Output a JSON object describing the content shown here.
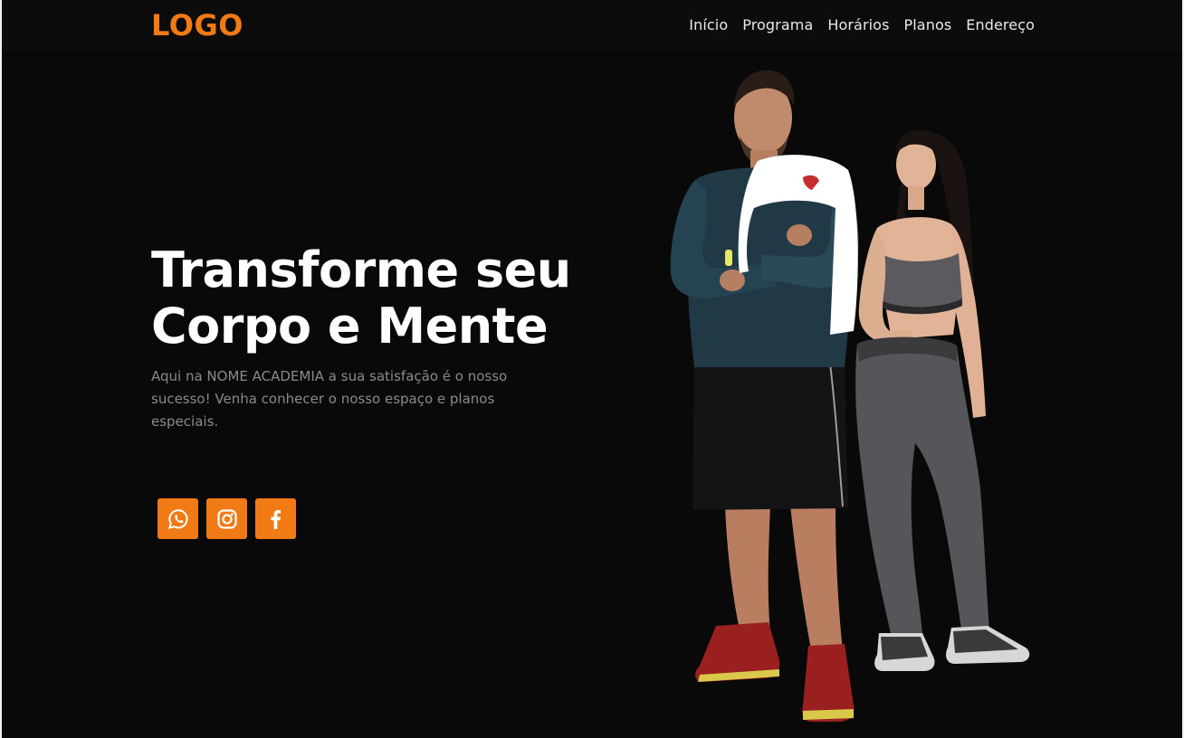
{
  "header": {
    "logo": "LOGO",
    "nav": [
      "Início",
      "Programa",
      "Horários",
      "Planos",
      "Endereço"
    ]
  },
  "hero": {
    "title_line1": "Transforme seu",
    "title_line2": "Corpo e Mente",
    "description": "Aqui na NOME ACADEMIA a sua satisfação é o nosso sucesso! Venha conhecer o nosso espaço e planos especiais."
  },
  "socials": {
    "icons": [
      "whatsapp-icon",
      "instagram-icon",
      "facebook-icon"
    ]
  },
  "colors": {
    "accent": "#f27a15",
    "background": "#0a090a",
    "text": "#ffffff",
    "muted": "#8a8a8a"
  }
}
